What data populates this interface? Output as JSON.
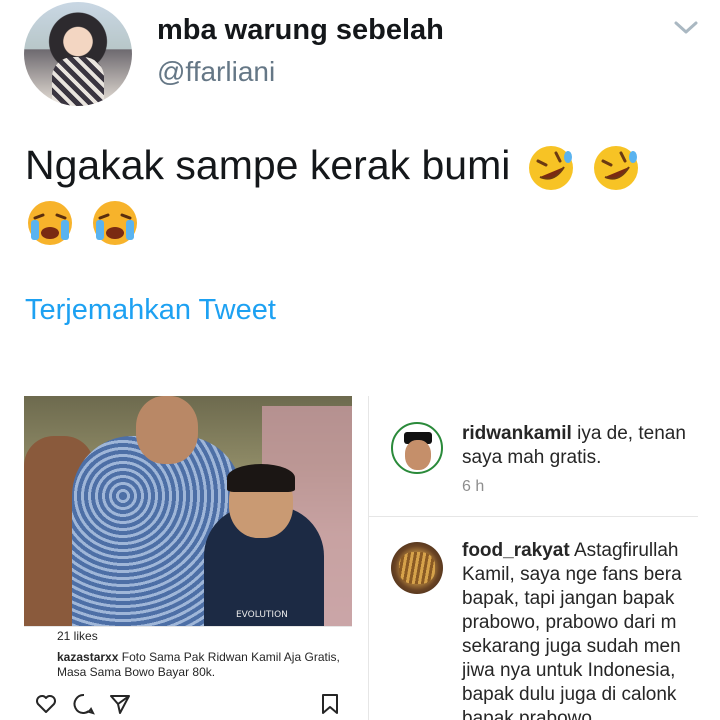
{
  "tweet": {
    "display_name": "mba warung sebelah",
    "handle": "@ffarliani",
    "text": "Ngakak sampe kerak bumi",
    "emojis": [
      "rolling-on-floor-laughing",
      "rolling-on-floor-laughing",
      "loudly-crying",
      "loudly-crying"
    ],
    "translate_label": "Terjemahkan Tweet"
  },
  "instagram_post": {
    "likes": "21 likes",
    "caption_user": "kazastarxx",
    "caption_text": "Foto Sama Pak Ridwan Kamil Aja Gratis, Masa Sama Bowo Bayar 80k.",
    "shirt_text": "EVOLUTION"
  },
  "comments": [
    {
      "user": "ridwankamil",
      "lines": [
        "iya de, tenan",
        "saya mah gratis."
      ],
      "time": "6 h"
    },
    {
      "user": "food_rakyat",
      "lines": [
        "Astagfirullah",
        "Kamil, saya nge fans bera",
        "bapak, tapi jangan bapak",
        "prabowo, prabowo dari m",
        "sekarang juga sudah men",
        "jiwa nya untuk Indonesia,",
        "bapak dulu juga di calonk",
        "bapak prabowo"
      ]
    }
  ],
  "colors": {
    "link": "#1da1f2",
    "secondary": "#657786",
    "text": "#14171a"
  }
}
